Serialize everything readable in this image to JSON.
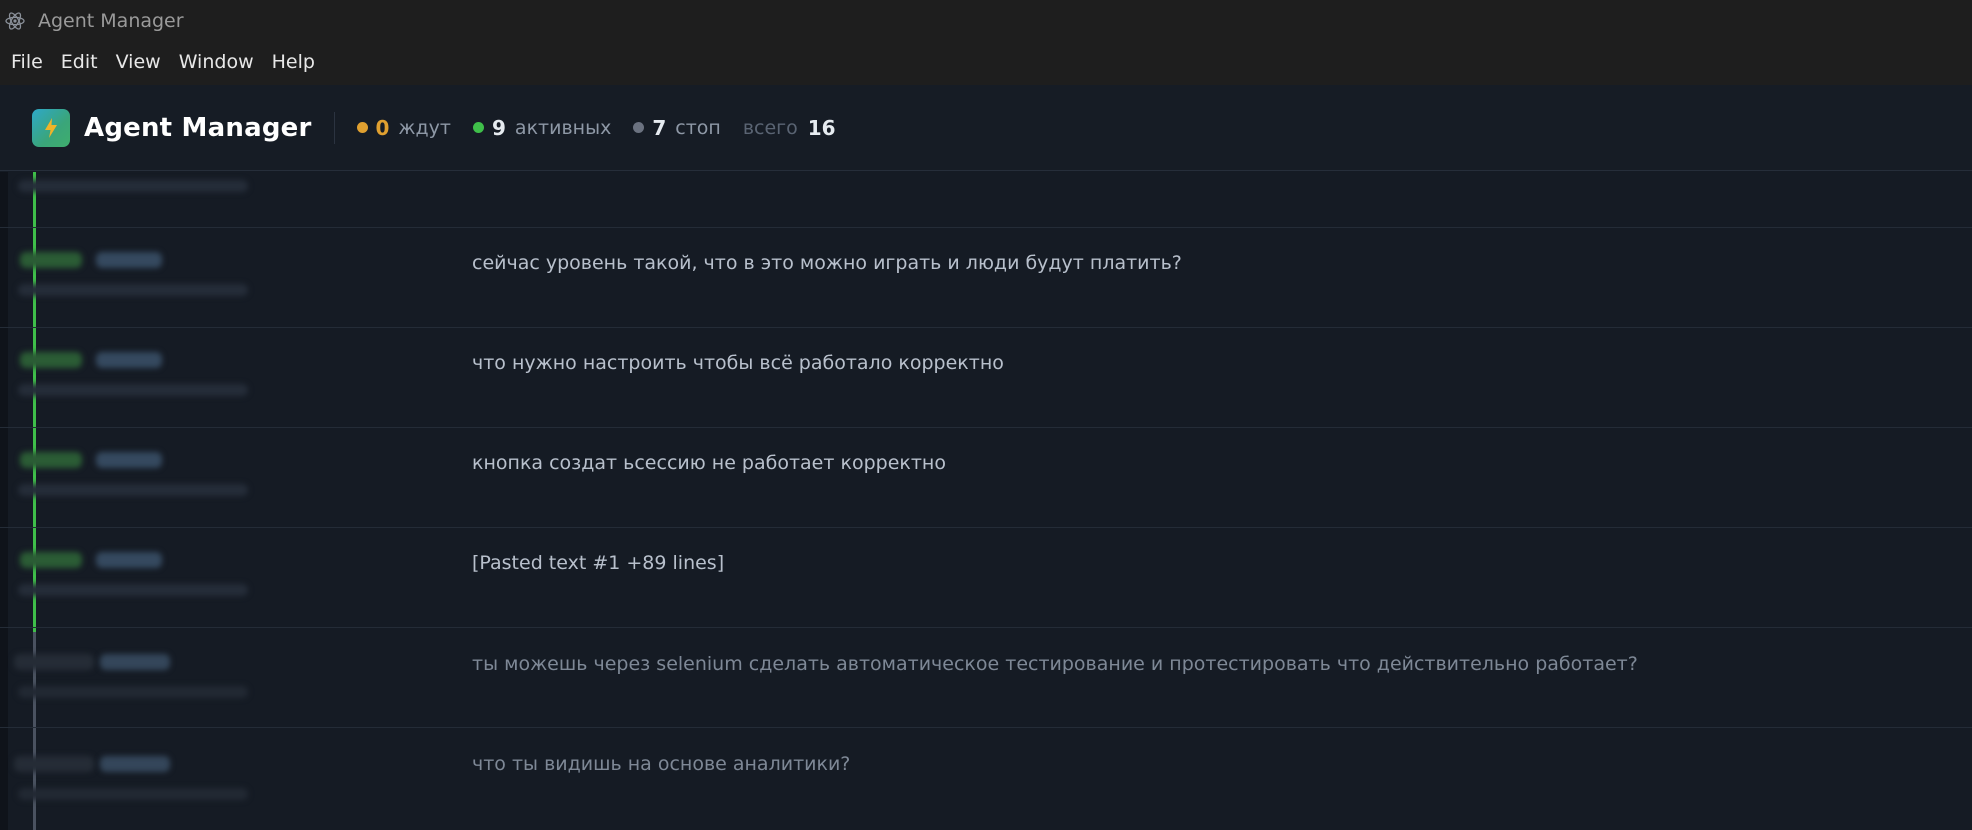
{
  "window": {
    "title": "Agent Manager"
  },
  "menu": [
    "File",
    "Edit",
    "View",
    "Window",
    "Help"
  ],
  "header": {
    "brand": "Agent Manager",
    "stats": {
      "waiting": {
        "count": "0",
        "label": "ждут",
        "color": "#e0a030"
      },
      "active": {
        "count": "9",
        "label": "активных",
        "color": "#3fbf4a"
      },
      "stopped": {
        "count": "7",
        "label": "стоп",
        "color": "#6b7280"
      },
      "total": {
        "label": "всего",
        "count": "16"
      }
    }
  },
  "colors": {
    "background": "#151b24",
    "active_line": "#3fbf4a",
    "inactive_line": "#4a5260",
    "text_active": "#b8c0cc",
    "text_inactive": "#7e8896"
  },
  "sessions": [
    {
      "message": "сейчас уровень такой, что в это можно играть и люди будут платить?",
      "status": "active"
    },
    {
      "message": "что нужно настроить чтобы всё работало корректно",
      "status": "active"
    },
    {
      "message": "кнопка создат ьсессию не работает корректно",
      "status": "active"
    },
    {
      "message": "[Pasted text #1 +89 lines]",
      "status": "active"
    },
    {
      "message": "ты можешь через selenium сделать автоматическое тестирование и протестировать что действительно работает?",
      "status": "stopped"
    },
    {
      "message": "что ты видишь на основе аналитики?",
      "status": "stopped"
    }
  ]
}
